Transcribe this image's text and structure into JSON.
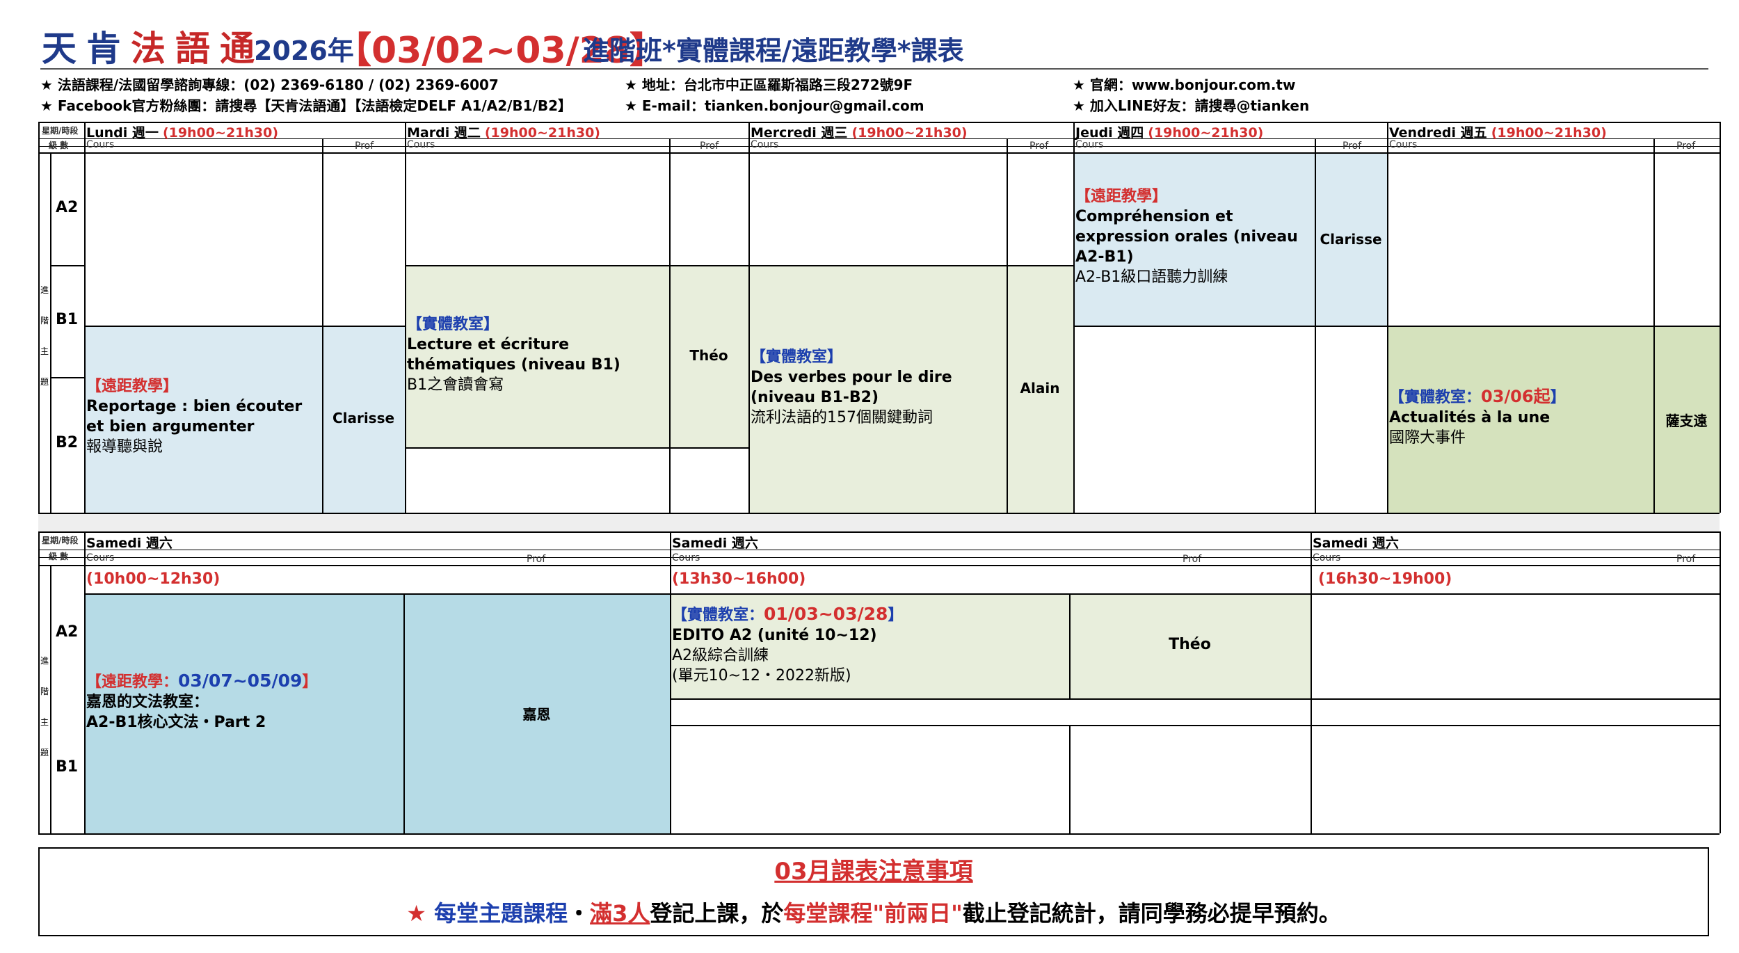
{
  "header": {
    "brand": [
      "天",
      "肯",
      "法",
      "語",
      "通"
    ],
    "year": "2026年",
    "dates": "【03/02~03/28】",
    "subtitle": "進階班*實體課程/遠距教學*課表"
  },
  "info": {
    "phone": "★ 法語課程/法國留學諮詢專線：(02) 2369-6180 / (02) 2369-6007",
    "address": "★ 地址：台北市中正區羅斯福路三段272號9F",
    "website": "★ 官網：www.bonjour.com.tw",
    "facebook": "★ Facebook官方粉絲團：請搜尋【天肯法語通】【法語檢定DELF A1/A2/B1/B2】",
    "email": "★ E-mail：tianken.bonjour@gmail.com",
    "line": "★ 加入LINE好友：請搜尋@tianken"
  },
  "labels": {
    "corner_top": "星期/時段",
    "corner_bottom": "級 數",
    "cours": "Cours",
    "prof": "Prof",
    "side_vertical": [
      "進",
      "階",
      "主",
      "題"
    ]
  },
  "weekday": {
    "days": [
      {
        "name": "Lundi 週一",
        "time": "(19h00~21h30)"
      },
      {
        "name": "Mardi 週二",
        "time": "(19h00~21h30)"
      },
      {
        "name": "Mercredi 週三",
        "time": "(19h00~21h30)"
      },
      {
        "name": "Jeudi 週四",
        "time": "(19h00~21h30)"
      },
      {
        "name": "Vendredi 週五",
        "time": "(19h00~21h30)"
      }
    ],
    "levels": [
      "A2",
      "B1",
      "B2"
    ],
    "courses": {
      "lundi": {
        "tag": "【遠距教學】",
        "title": "Reportage : bien écouter et bien argumenter",
        "zh": "報導聽與說",
        "prof": "Clarisse"
      },
      "mardi": {
        "tag": "【實體教室】",
        "title": "Lecture et écriture thématiques (niveau B1)",
        "zh": "B1之會讀會寫",
        "prof": "Théo"
      },
      "mercredi": {
        "tag": "【實體教室】",
        "title": "Des verbes pour le dire (niveau B1-B2)",
        "zh": "流利法語的157個關鍵動詞",
        "prof": "Alain"
      },
      "jeudi": {
        "tag": "【遠距教學】",
        "title": "Compréhension et expression orales (niveau A2-B1)",
        "zh": "A2-B1級口語聽力訓練",
        "prof": "Clarisse"
      },
      "vendredi": {
        "tag": "【實體教室：",
        "tag_date": "03/06起",
        "tag_end": "】",
        "title": "Actualités à la une",
        "zh": "國際大事件",
        "prof": "薩支遠"
      }
    }
  },
  "saturday": {
    "days": [
      "Samedi 週六",
      "Samedi 週六",
      "Samedi 週六"
    ],
    "times": [
      "(10h00~12h30)",
      "(13h30~16h00)",
      "(16h30~19h00)"
    ],
    "levels": [
      "A2",
      "B1"
    ],
    "courses": {
      "morning": {
        "tag": "【遠距教學：",
        "tag_date": "03/07~05/09",
        "tag_end": "】",
        "line1": "嘉恩的文法教室：",
        "line2": "A2-B1核心文法・Part 2",
        "prof": "嘉恩"
      },
      "afternoon": {
        "tag": "【實體教室：",
        "tag_date": "01/03~03/28",
        "tag_end": "】",
        "title": "EDITO A2 (unité 10~12)",
        "zh1": "A2級綜合訓練",
        "zh2": "(單元10~12・2022新版)",
        "prof": "Théo"
      }
    }
  },
  "notice": {
    "title": "03月課表注意事項",
    "star": "★ ",
    "p1": "每堂主題課程",
    "p2": "・",
    "p3": "滿3人",
    "p4": "登記上課，於",
    "p5": "每堂課程\"前兩日\"",
    "p6": "截止登記統計，請同學務必提早預約。"
  },
  "colors": {
    "brand_blue": "#1f3a8a",
    "accent_red": "#d32f2f",
    "remote_bg": "#daeaf2",
    "classroom_bg": "#e8eedc",
    "highlight_bg": "#d5e2bd",
    "saturday_remote_bg": "#b6dbe6"
  }
}
